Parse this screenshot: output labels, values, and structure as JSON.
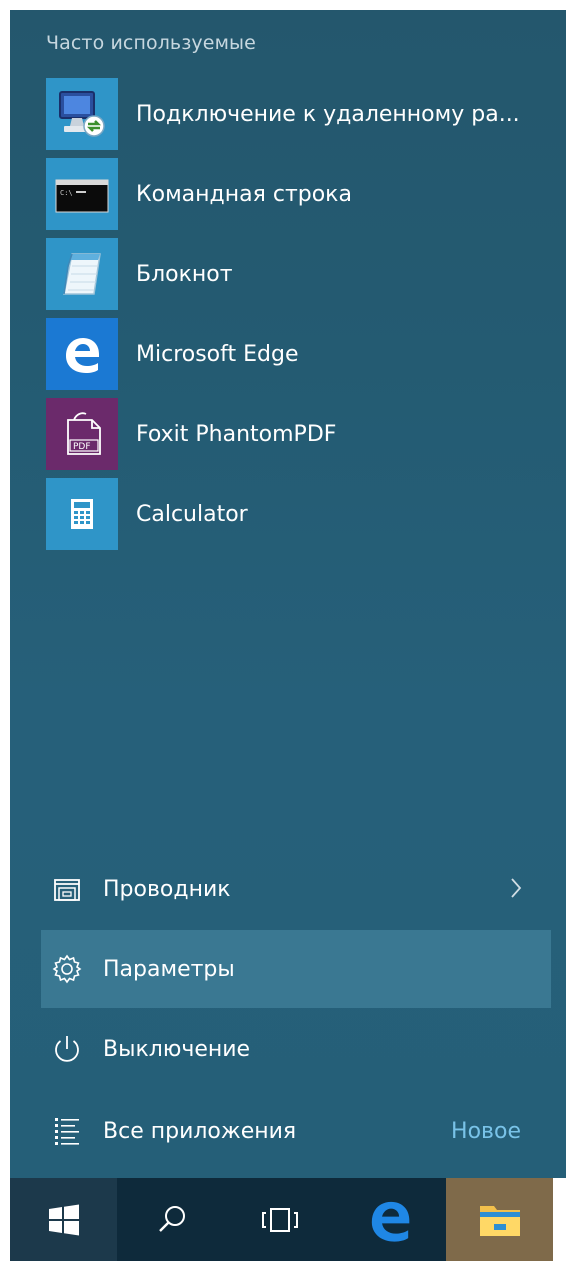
{
  "start_menu": {
    "section_header": "Часто используемые",
    "apps": [
      {
        "label": "Подключение к удаленному ра...",
        "icon": "remote-desktop-icon",
        "tile_color": "#2f95c8"
      },
      {
        "label": "Командная строка",
        "icon": "command-prompt-icon",
        "tile_color": "#2f95c8"
      },
      {
        "label": "Блокнот",
        "icon": "notepad-icon",
        "tile_color": "#2f95c8"
      },
      {
        "label": "Microsoft Edge",
        "icon": "edge-icon",
        "tile_color": "#1b79d3"
      },
      {
        "label": "Foxit PhantomPDF",
        "icon": "foxit-pdf-icon",
        "tile_color": "#6b2a6b"
      },
      {
        "label": "Calculator",
        "icon": "calculator-icon",
        "tile_color": "#2f95c8"
      }
    ],
    "bottom": {
      "explorer": {
        "label": "Проводник",
        "icon": "file-explorer-icon"
      },
      "settings": {
        "label": "Параметры",
        "icon": "gear-icon"
      },
      "power": {
        "label": "Выключение",
        "icon": "power-icon"
      },
      "all_apps": {
        "label": "Все приложения",
        "icon": "list-icon",
        "badge": "Новое"
      }
    }
  },
  "taskbar": {
    "buttons": [
      "windows-logo-icon",
      "search-icon",
      "task-view-icon",
      "edge-icon",
      "file-explorer-icon"
    ]
  },
  "colors": {
    "menu_background": "#255a71",
    "highlight": "#3a7892",
    "accent_text": "#79c3e8",
    "taskbar": "#0e2a3b"
  }
}
